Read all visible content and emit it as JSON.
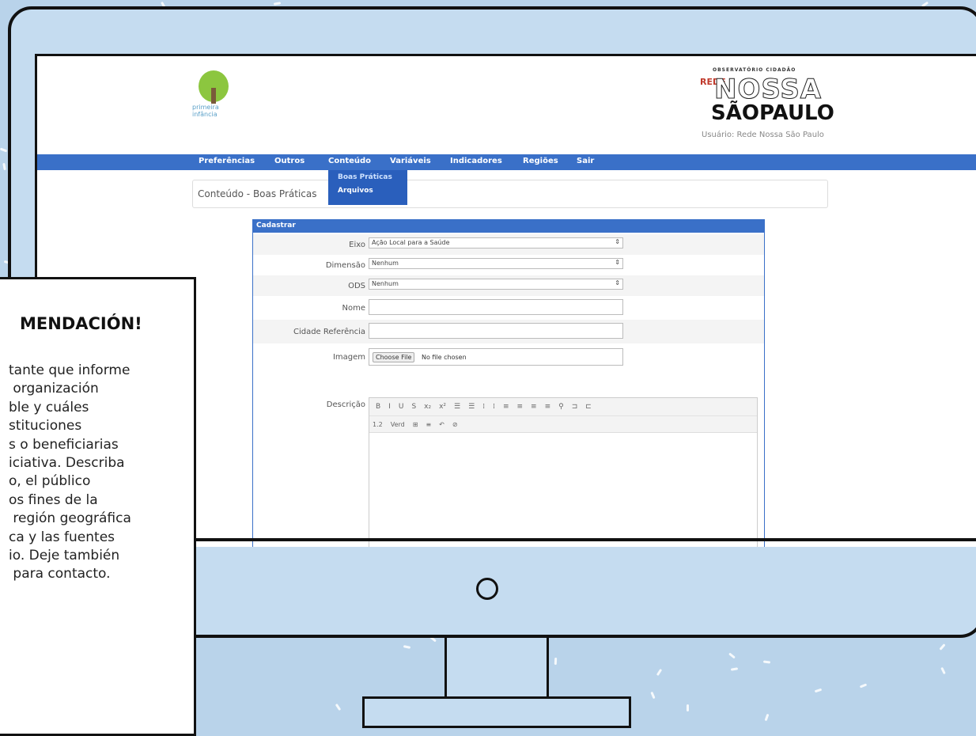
{
  "site": {
    "logo_left_text": "primeira infância",
    "logo_right": {
      "small": "OBSERVATÓRIO CIDADÃO",
      "rede": "REDE",
      "nossa": "NOSSA",
      "saopaulo": "SÃOPAULO",
      "user": "Usuário: Rede Nossa São Paulo"
    }
  },
  "nav": {
    "items": [
      "Preferências",
      "Outros",
      "Conteúdo",
      "Variáveis",
      "Indicadores",
      "Regiões",
      "Sair"
    ],
    "dropdown": [
      "Boas Práticas",
      "Arquivos"
    ]
  },
  "breadcrumb": "Conteúdo - Boas Práticas",
  "form": {
    "header": "Cadastrar",
    "eixo_label": "Eixo",
    "eixo_value": "Ação Local para a Saúde",
    "dimensao_label": "Dimensão",
    "dimensao_value": "Nenhum",
    "ods_label": "ODS",
    "ods_value": "Nenhum",
    "nome_label": "Nome",
    "cidade_label": "Cidade Referência",
    "imagem_label": "Imagem",
    "choose_file": "Choose File",
    "no_file": "No file chosen",
    "descricao_label": "Descrição",
    "toolbar_row1": [
      "B",
      "I",
      "U",
      "S",
      "x₂",
      "x²",
      "☰",
      "☰",
      "⁞",
      "⁞",
      "≡",
      "≡",
      "≡",
      "≡",
      "⚲",
      "⊐",
      "⊏"
    ],
    "toolbar_row2": [
      "1.2",
      "Verd",
      "⊞",
      "≡",
      "↶",
      "⊘"
    ]
  },
  "card": {
    "title": "MENDACIÓN!",
    "text": "tante que informe\n organización\nble y cuáles\nstituciones\ns o beneficiarias\niciativa. Describa\no, el público\nos fines de la\n región geográfica\nca y las fuentes\nio. Deje también\n para contacto."
  },
  "colors": {
    "background": "#b9d3ea",
    "monitor": "#c5dcf0",
    "navbar": "#3a70c8"
  }
}
